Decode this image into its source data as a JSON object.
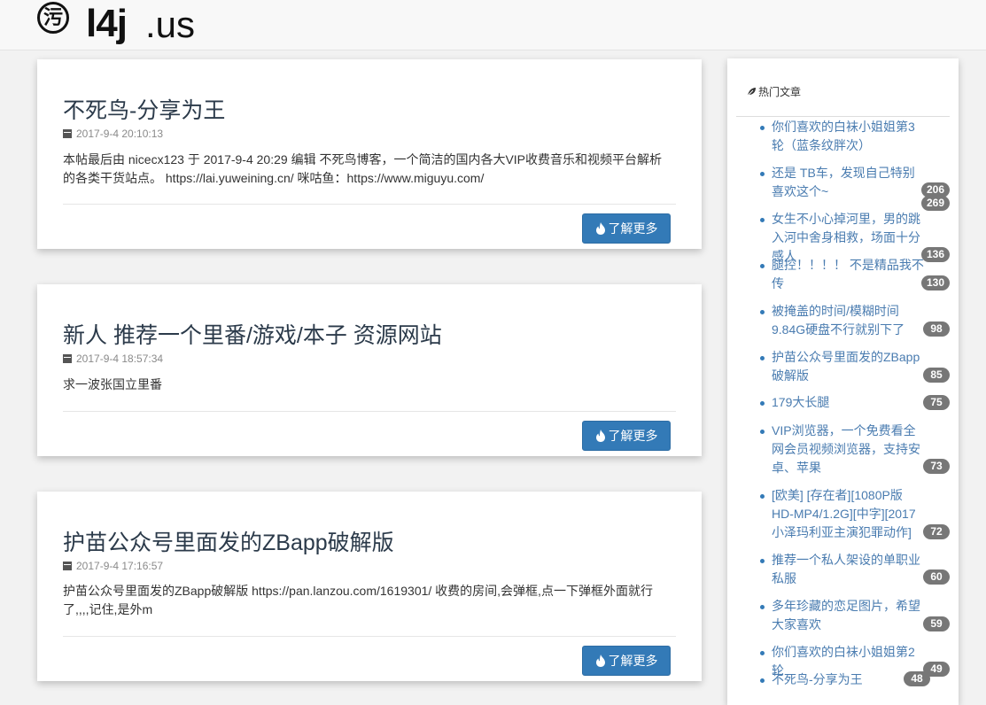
{
  "site": {
    "logo_char": "污",
    "brand_main": "l4j",
    "brand_tld": ".us"
  },
  "posts": [
    {
      "title": "不死鸟-分享为王",
      "date": "2017-9-4 20:10:13",
      "excerpt": "本帖最后由 nicecx123 于 2017-9-4 20:29 编辑 不死鸟博客，一个简洁的国内各大VIP收费音乐和视频平台解析的各类干货站点。 https://lai.yuweining.cn/ 咪咕鱼：https://www.miguyu.com/",
      "button": "了解更多"
    },
    {
      "title": "新人 推荐一个里番/游戏/本子 资源网站",
      "date": "2017-9-4 18:57:34",
      "excerpt": "求一波张国立里番",
      "button": "了解更多"
    },
    {
      "title": "护苗公众号里面发的ZBapp破解版",
      "date": "2017-9-4 17:16:57",
      "excerpt": "护苗公众号里面发的ZBapp破解版 https://pan.lanzou.com/1619301/ 收费的房间,会弹框,点一下弹框外面就行了,,,,记住,是外m",
      "button": "了解更多"
    }
  ],
  "sidebar": {
    "heading": "热门文章",
    "items": [
      {
        "title": "你们喜欢的白袜小姐姐第3轮（蓝条纹胖次）",
        "count": "269"
      },
      {
        "title": "还是 TB车，发现自己特别喜欢这个~",
        "count": "206"
      },
      {
        "title": "女生不小心掉河里，男的跳入河中舍身相救，场面十分感人",
        "count": "136"
      },
      {
        "title": "腿控！！！！ 不是精品我不传",
        "count": "130"
      },
      {
        "title": "被掩盖的时间/模糊时间 9.84G硬盘不行就别下了",
        "count": "98"
      },
      {
        "title": "护苗公众号里面发的ZBapp破解版",
        "count": "85"
      },
      {
        "title": "179大长腿",
        "count": "75"
      },
      {
        "title": "VIP浏览器，一个免费看全网会员视频浏览器，支持安卓、苹果",
        "count": "73"
      },
      {
        "title": "[欧美] [存在者][1080P版HD-MP4/1.2G][中字][2017小泽玛利亚主演犯罪动作]",
        "count": "72"
      },
      {
        "title": "推荐一个私人架设的单职业私服",
        "count": "60"
      },
      {
        "title": "多年珍藏的恋足图片，希望大家喜欢",
        "count": "59"
      },
      {
        "title": "你们喜欢的白袜小姐姐第2轮",
        "count": "49"
      },
      {
        "title": "不死鸟-分享为王",
        "count": "48"
      }
    ]
  }
}
